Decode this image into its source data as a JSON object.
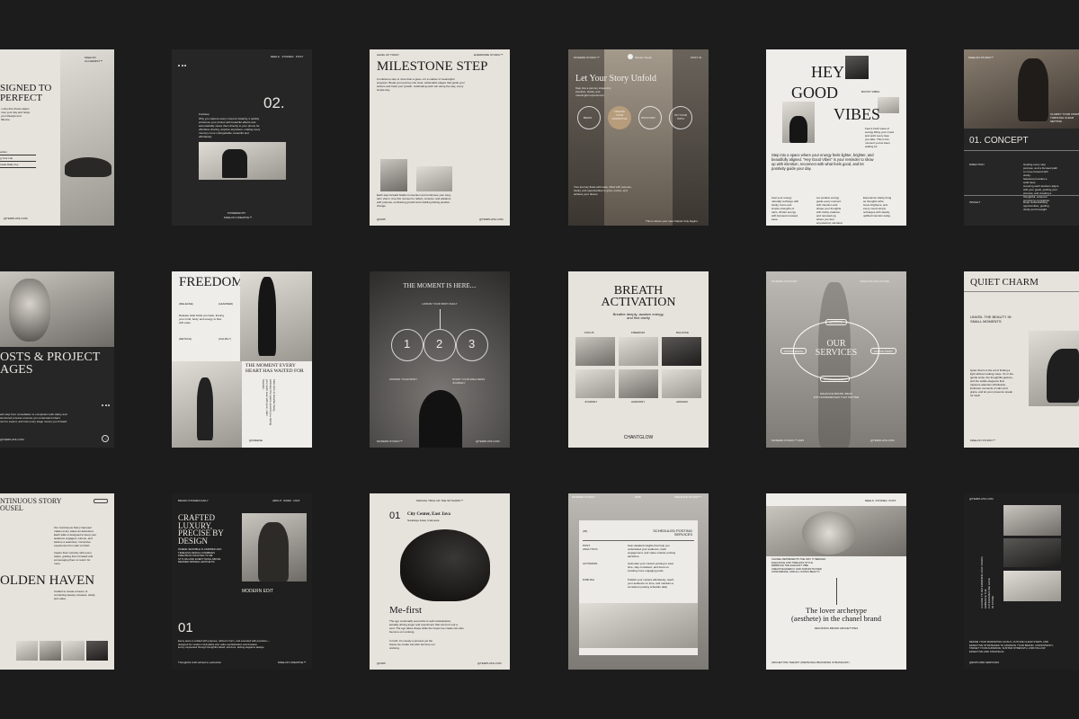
{
  "tiles": {
    "t1": {
      "header": "MAELON ALCHEMIST™",
      "title": "SIGNED TO\nPERFECT",
      "body": "n why this choice aligns\nrove your day and helps\nyour lifestyle and\nfidence.",
      "items": [
        "ection",
        "g Your Life",
        "ovate Daily Joy"
      ],
      "footer": "@TEMPLATE.COM"
    },
    "t2": {
      "nav": [
        "REELS",
        "STORIES",
        "POST"
      ],
      "number": "02.",
      "sub": "Footstep",
      "body": "Why you capture every moment instantly, it quickly\nenhances your photos with beautiful effects and\nautomatically saves them directly to your phone for\neffortless sharing, anytime anywhere, making every\nmemory more unforgettable, beautiful and\neffortlessly.",
      "foot1": "POWERED BY",
      "foot2": "MAELON CREATIVE™"
    },
    "t3": {
      "top_left": "LEVEL UP TODAY",
      "top_right": "EVERMORE STUDIO™",
      "title": "MILESTONE STEP",
      "intro": "A milestone step is more than a goal—it's a marker of meaningful\nprogress. Break your journey into clear, achievable stages that guide your\nactions and track your growth, celebrating each win along the way, every\nsimple day.",
      "body": "Each step forward builds momentum and reinforces your long-\nterm vision. Use this moment to reflect, recenter, and advance\nwith purpose, embracing growth and crediting lasting positive\nchange.",
      "foot_left": "@2025",
      "foot_right": "@TEMPLATE.COM"
    },
    "t4": {
      "top_left": "MODERN STUDIO™",
      "profile": "Maelon Studio",
      "top_right": "POST 01",
      "title": "Let Your Story Unfold",
      "intro": "Step into a journey shaped by\nintention, clarity, and\nmeaningful experiences.",
      "circles": [
        "BEGIN",
        "CREATE\nYOUR\nNARRATIVE",
        "DISCOVER",
        "ON YOUR\nPATH"
      ],
      "body": "Your journey flows with ease, lifted with purpose,\nclarity, and opportunities to grow, evolve, and\nachieve your dream.",
      "footer": "This is where your new chapter truly begins."
    },
    "t5": {
      "title_a": "HEY",
      "title_b": "GOOD",
      "title_c": "VIBES",
      "label": "BOOST VIBES",
      "side": "Feel a fresh wave of\nenergy lifting your mood\nand spirit every step\nyou take. This is the\nmoment you've been\nwaiting for.",
      "body": "Step into a space where your energy feels lighter, brighter, and\nbeautifully aligned. \"Hey Good Vibes\" is your reminder to show\nup with intention, reconnect with what feels good, and let\npositivity guide your day.",
      "cols": [
        "Feel your energy\nnaturally recharge with\nclarity, focus and\nsimple strengths of\ncalm, vibrant energy\nwith focused renewed\nease.",
        "Let positive energy\nguide every moment\nwith intention and\nshape your thoughts\nwith clarity, balance,\nand renewed joy\nwhere you feel\nempowered, elevated\nand balanced shift.",
        "Experience clarity bring\nas thoughts write\nfocus brightens, and\nevery mood simply\nrecharges with steady,\nuplifted intention today."
      ]
    },
    "t6": {
      "top_left": "MAELON STUDIO™",
      "side": "CLARIFY YOUR VISION\nTHROUGH CLEAR\nSETTING",
      "title": "01. CONCEPT",
      "rows": [
        {
          "k": "DIRECTION",
          "v": "Guiding every step\npurpose, and a focused path\nto move forward with\nclarity."
        },
        {
          "k": "",
          "v": "Selected provides a\nsolid base\nensuring each decision aligns\nwith your goals, guiding your\nprocess, and creating a\nthoughtful, coherent\nconcept to completion."
        },
        {
          "k": "INSIGHT",
          "v": "Deep understanding\nopportunities, guiding\nclarity and foresight."
        }
      ]
    },
    "t7": {
      "title": "OSTS & PROJECT\nAGES",
      "body": "ach step from consultation to completion with clarity and\nstructured process ensures you understand what's\nnext to expect, and how every stage moves you forward",
      "footer": "@TEMPLATE.COM"
    },
    "t8": {
      "title": "FREEDOM",
      "r1_l": "(RELEASE)",
      "r1_r": "(LEARNED)",
      "text": "Release what holds you back, freeing\nyour mind, body, and energy to flow\nwith ease.",
      "r2_l": "(DETACH)",
      "r2_r": "(CALMLY)",
      "quote": "THE MOMENT EVERY\nHEART HAS WAITED FOR",
      "vertical": "Take time to breathe freely,\nembrace the space around you, letting\nyour spirit soar with pure, calm\nfreedom.",
      "footer": "@FREESE"
    },
    "t9": {
      "title": "THE MOMENT IS HERE....",
      "sub": "HONOR YOUR BODY DAILY",
      "numbers": [
        "1",
        "2",
        "3"
      ],
      "left": "UNWIND YOUR BODY",
      "right": "START YOUR WELLNESS\nJOURNEY",
      "foot_left": "MODERN STUDIO™",
      "foot_right": "@TEMPLATE.COM"
    },
    "t10": {
      "title": "BREATH\nACTIVATION",
      "sub": "Breathe deeply, awaken energy,\nand find clarity",
      "labels_top": [
        "FOCUS",
        "FREEDOM",
        "BALANCE"
      ],
      "labels_bottom": [
        "JOURNEY",
        "HARMONY",
        "AWAKEN"
      ],
      "footer": "CHANTGLOW"
    },
    "t11": {
      "top_left": "MODERN SUPPORT",
      "top_right": "CREATIVE SOLUTIONS",
      "pills": [
        "BRANDING",
        "SOCIAL MEDIA",
        "OFFICE PRINT",
        "ADVERTISEMENT"
      ],
      "title": "OUR\nSERVICES",
      "sub": "ENHANCE BRAND IDEAS\nINTO EXPERIENCES THAT MATTER",
      "foot_left": "MODERN STUDIO™ 2025",
      "foot_right": "@TEMPLATE.COM"
    },
    "t12": {
      "title": "QUIET CHARM",
      "sub": "UNVEIL THE BEAUTY IN\nSMALL MOMENTS",
      "body": "Quiet charm is the art of finding a\nlight without making noise. It's in the\ngentle smile, the thoughtful gesture,\nand the subtle elegance that\ncaptures attention effortlessly.\nEmbrace moments of calm and\ngrace, and let your presence speak\nfor itself.",
      "footer": "MAELON STUDIO™"
    },
    "t13": {
      "title": "NTINUOUS STORY\nOUSEL",
      "body": "Our Continuous Story Carousel\nmakes every swipe an adventure.\nEach slide is designed to keep your\naudience engaged, curious, and\nbelieve a seamless, immersive\nexperience from start to finish.",
      "body2": "Inspire their curiosity with every\nswipe, guiding them forward and\nencouraging them to return for\nmore.",
      "headline": "OLDEN HAVEN",
      "body3": "Crafted to create a haven of\ncomforting beauty, timeless, clarity\nand value."
    },
    "t14": {
      "top_left": "BRAND STORIES DAILY",
      "nav": [
        "ABOUT",
        "WORK",
        "VISIT"
      ],
      "title": "CRAFTED\nLUXURY,\nPRECISE BY\nDESIGN",
      "sub": "WHERE SENSIBLE IS ADMIRED AND\nTIMELESS DESIGN COMBINES\nPRECISION CRAFTED TO BE\nSTYLISH AND EVERYTHING ABOVE\nREFINED MINIMAL AESTHETIC",
      "label": "MODERN EDIT",
      "number": "01",
      "body": "Every piece is crafted with purpose, refined in form, and executed with precision—\ndesigned for modern minimalists who value sophistication and timeless\nluxury expressed through thoughtful detail, structure, lasting elegance always.",
      "foot_left": "Thoughtful craft refined to perfection",
      "foot_right": "MAELON CREATIVE™"
    },
    "t15": {
      "top_left": "MANUAL TRIAL OF THE SKYHAWK™",
      "number": "01",
      "place": "City Center, East Java",
      "place2": "Surabaya Jawa, Indonesia",
      "title": "Me-first",
      "body": "The ego continually succumbs to self-consideration,\nactually driving anger and resentment that can burn out a\nsoul. The ego takes shape while the hopes we create can also\nbecome our undoing.",
      "body2": "In truth, it's merely a process yet the\nhopes we create can also become our\nundoing.",
      "foot_left": "@2025",
      "foot_right": "@TEMPLATE.COM"
    },
    "t16": {
      "top_left": "MODERN STUDIO",
      "top_mid": "2025",
      "top_right": "CREATIVE STUDIO™",
      "number": "(05)",
      "title": "SCHEDULED POSTING\nSERVICES",
      "rows": [
        {
          "k": "POST\nANALYTICS",
          "v": "Gain detailed insights that help you\nunderstand your audience, track\nengagement, and make smarter posting\ndecisions."
        },
        {
          "k": "AUTOMATE",
          "v": "Automate your content posting to save\ntime, stay consistent, and focus on\ncreating more engaging posts."
        },
        {
          "k": "PUBLISH",
          "v": "Publish your content effortlessly, reach\nyour audience on time, and maintain a\nconsistent posting schedule daily."
        }
      ]
    },
    "t17": {
      "nav": [
        "REELS",
        "STORIES",
        "POST"
      ],
      "side_left": "CHANEL REPRESENTS THE WAY IT MERGES\nELEGANCE AND TIMELESS STYLE\nEMBRACE THE ELEGANT VIBE\nCREATIVE ENERGY AND SOPHISTICATED\nCONFIDENCE, AND ALL ICONIC BEAUTY.",
      "title": "The lover archetype\n(aesthete) in the chanel brand",
      "sub": "DECODING BRAND ARCHETYPES",
      "footer": "ARCHETYPE THEORY (PERSONAL BRANDING STRATEGIST)"
    },
    "t18": {
      "top": "@TEMPLATE.COM",
      "vertical": "A GUIDE TO DETERMINING OUR VISION,\nEMBRACE THE\nCATEGORIES WE HAVE\nIN STORE",
      "body": "DEFINE YOUR MARKETING GOALS, OUTLINE CLEAR STEPS, AND\nEFFECTIVE STRATEGIES TO ADVANCE YOUR BRAND, CONSISTENCY,\nTARGET YOUR AUDIENCE, SUSTAIN STRENGTH, AND FOLLOW\nEFFECTIVE AND STRATEGIC.",
      "footer": "@EXPLORE SERVICES"
    }
  },
  "colors": {
    "background": "#1c1c1c",
    "tile_light": "#e6e3dd",
    "tile_dark": "#262626",
    "accent_tan": "#b79c7c"
  }
}
